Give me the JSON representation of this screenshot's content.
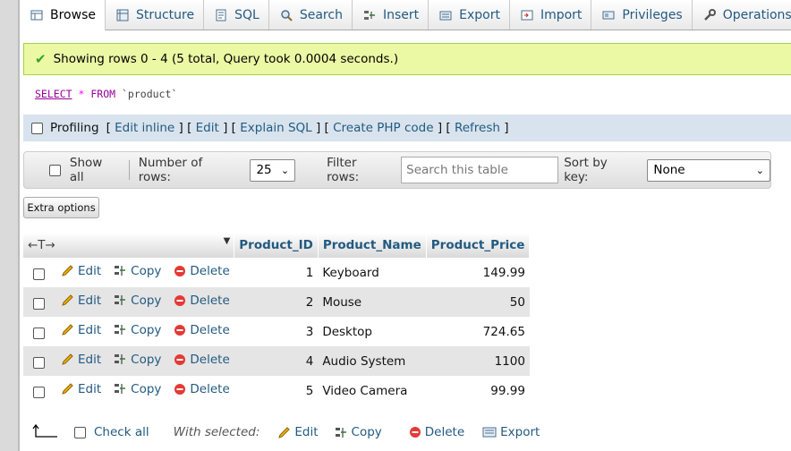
{
  "tabs": [
    {
      "label": "Browse",
      "icon": "browse-icon",
      "active": true
    },
    {
      "label": "Structure",
      "icon": "structure-icon"
    },
    {
      "label": "SQL",
      "icon": "sql-icon"
    },
    {
      "label": "Search",
      "icon": "search-icon"
    },
    {
      "label": "Insert",
      "icon": "insert-icon"
    },
    {
      "label": "Export",
      "icon": "export-icon"
    },
    {
      "label": "Import",
      "icon": "import-icon"
    },
    {
      "label": "Privileges",
      "icon": "privileges-icon"
    },
    {
      "label": "Operations",
      "icon": "operations-icon"
    }
  ],
  "message": "Showing rows 0 - 4 (5 total, Query took 0.0004 seconds.)",
  "sql": {
    "kw1": "SELECT",
    "star": "*",
    "kw2": "FROM",
    "table": "`product`"
  },
  "profiling": {
    "label": "Profiling",
    "links": [
      "Edit inline",
      "Edit",
      "Explain SQL",
      "Create PHP code",
      "Refresh"
    ]
  },
  "nav": {
    "show_all": "Show all",
    "rows_label": "Number of rows:",
    "rows_value": "25",
    "filter_label": "Filter rows:",
    "filter_placeholder": "Search this table",
    "sort_label": "Sort by key:",
    "sort_value": "None"
  },
  "extra_options": "Extra options",
  "table": {
    "arrows": "←T→",
    "columns": [
      "Product_ID",
      "Product_Name",
      "Product_Price"
    ],
    "action_labels": {
      "edit": "Edit",
      "copy": "Copy",
      "delete": "Delete"
    },
    "rows": [
      {
        "id": "1",
        "name": "Keyboard",
        "price": "149.99"
      },
      {
        "id": "2",
        "name": "Mouse",
        "price": "50"
      },
      {
        "id": "3",
        "name": "Desktop",
        "price": "724.65"
      },
      {
        "id": "4",
        "name": "Audio System",
        "price": "1100"
      },
      {
        "id": "5",
        "name": "Video Camera",
        "price": "99.99"
      }
    ]
  },
  "footer": {
    "check_all": "Check all",
    "with_selected": "With selected:",
    "edit": "Edit",
    "copy": "Copy",
    "delete": "Delete",
    "export": "Export"
  },
  "colors": {
    "link": "#235a81",
    "success_bg": "#ebf8a4",
    "row_alt": "#e5e5e5"
  }
}
